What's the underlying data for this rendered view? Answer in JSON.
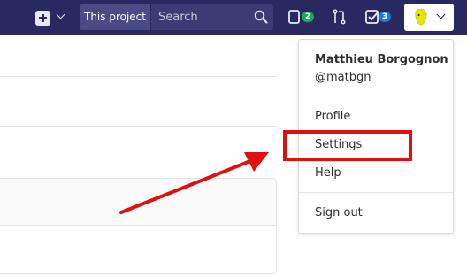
{
  "navbar": {
    "search_scope": "This project",
    "search_placeholder": "Search",
    "issues_count": "2",
    "todos_count": "3"
  },
  "user_menu": {
    "name": "Matthieu Borgognon",
    "handle": "@matbgn",
    "items": [
      {
        "label": "Profile"
      },
      {
        "label": "Settings"
      },
      {
        "label": "Help"
      }
    ],
    "sign_out": "Sign out"
  },
  "annotation": {
    "color": "#e01010",
    "target": "Settings"
  },
  "colors": {
    "navbar": "#292961",
    "badge_green": "#1aaa55",
    "badge_blue": "#1f78d1"
  }
}
